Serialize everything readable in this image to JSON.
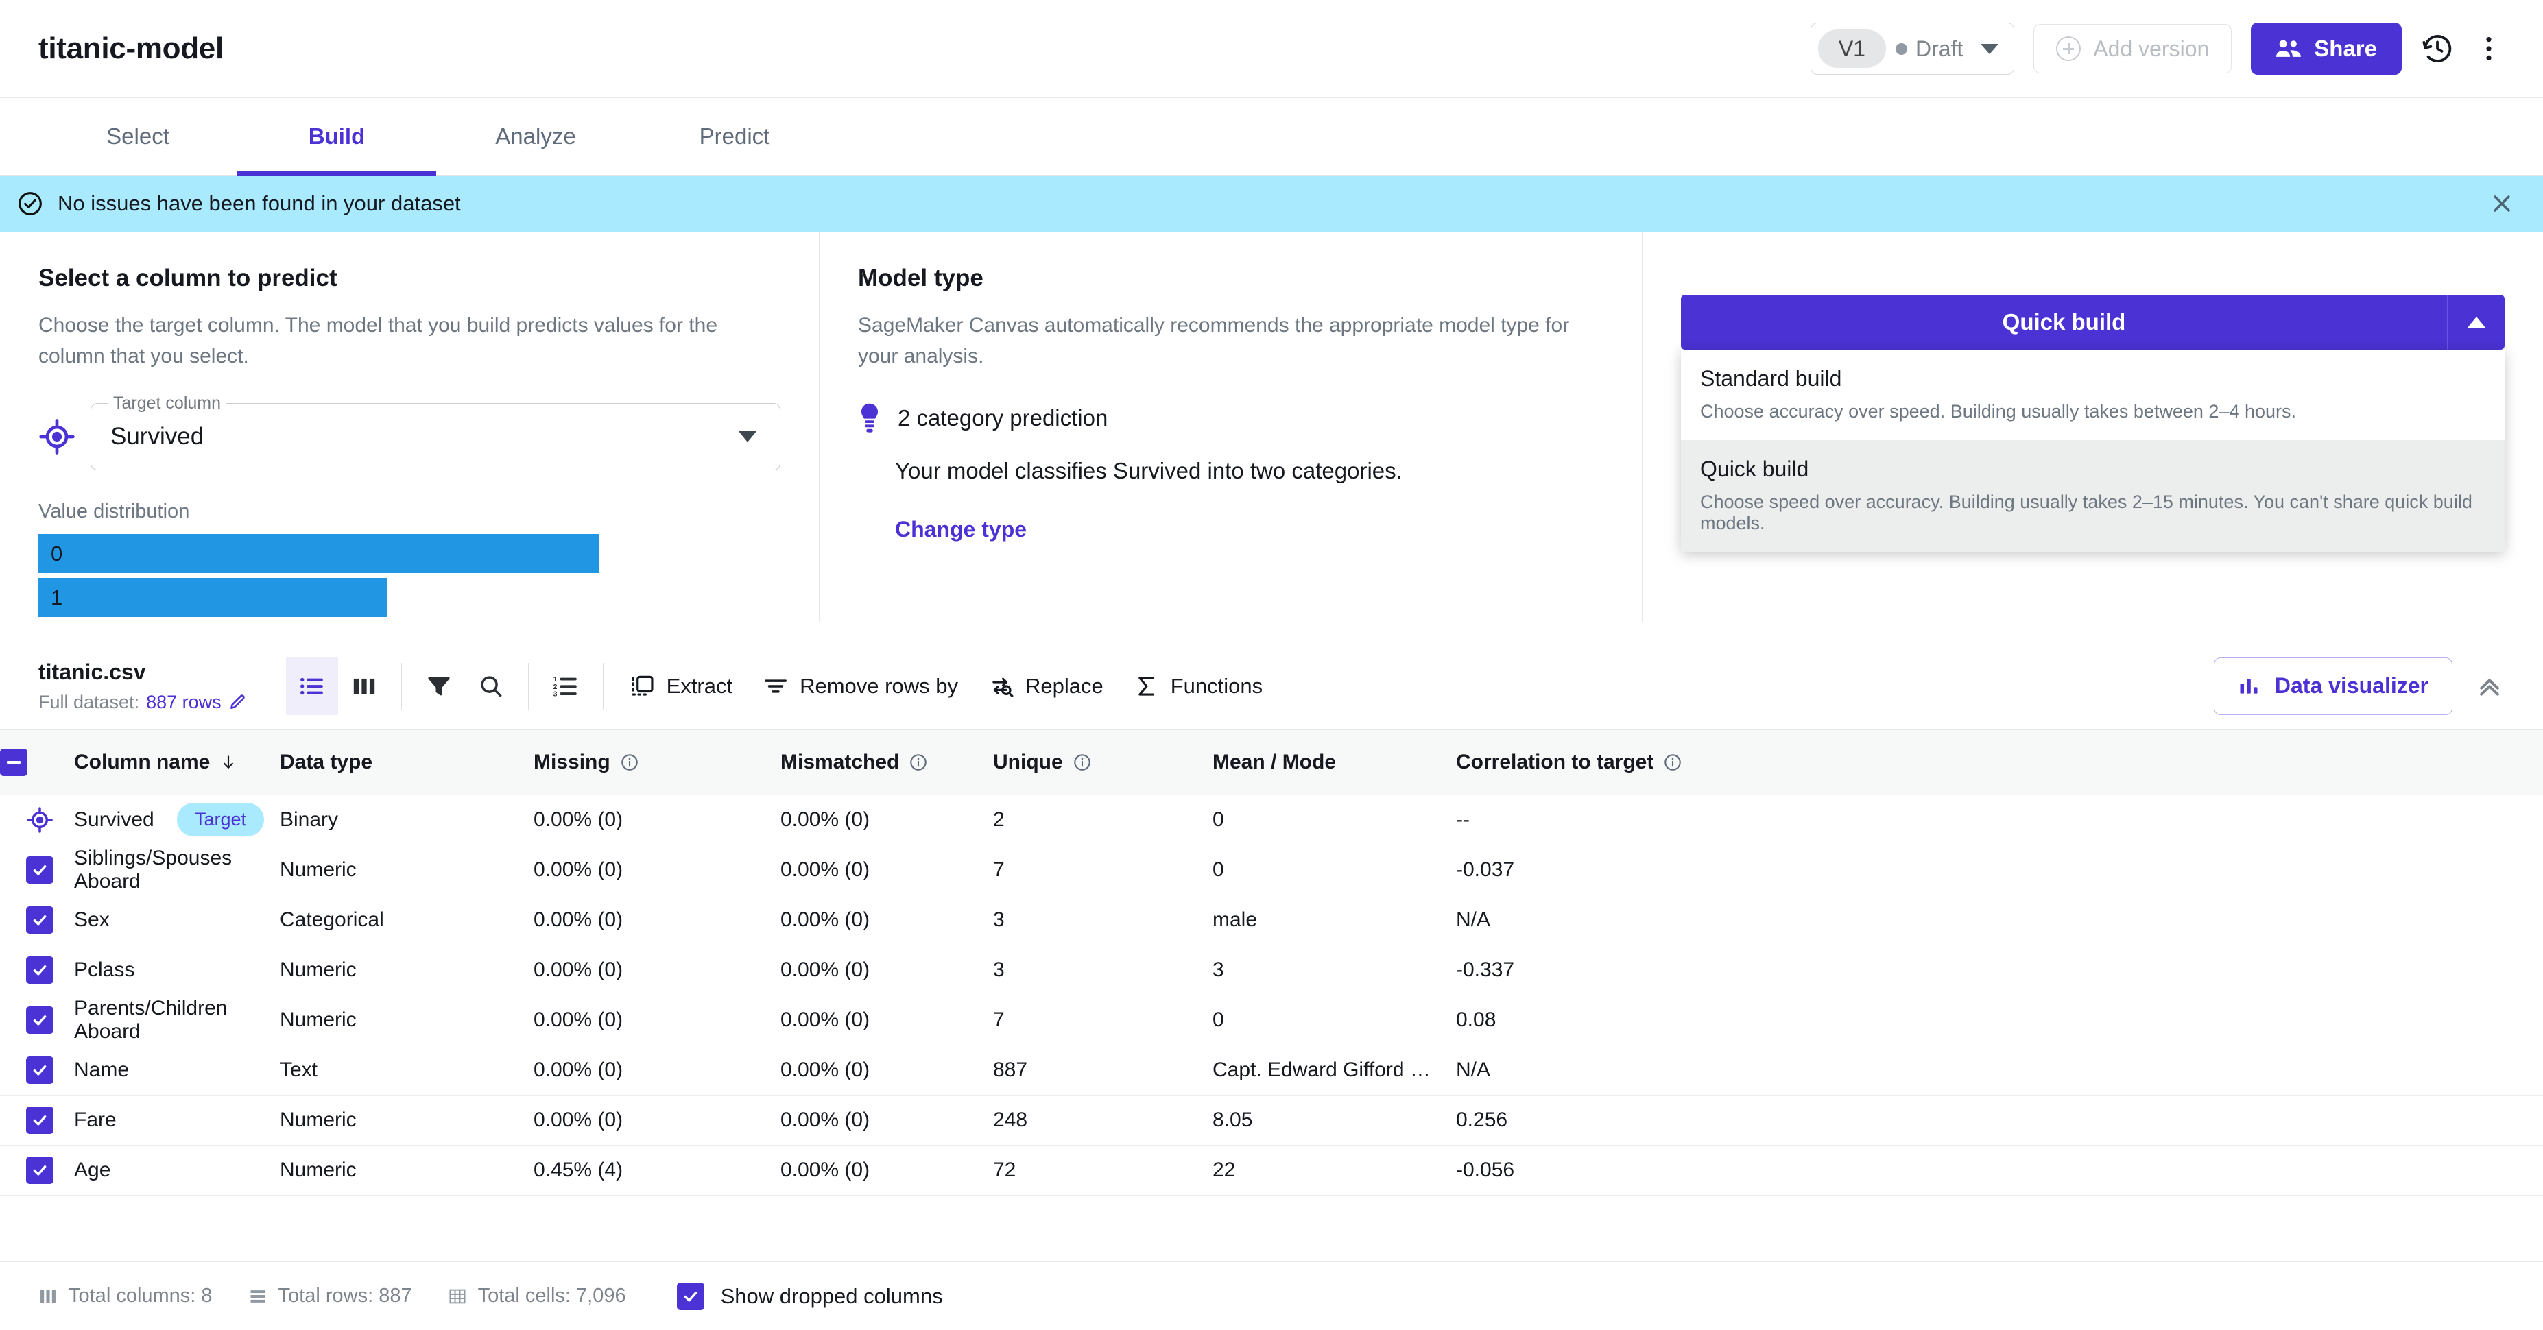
{
  "header": {
    "model_title": "titanic-model",
    "version_label": "V1",
    "status_label": "Draft",
    "add_version_label": "Add version",
    "share_label": "Share",
    "history_icon": "history-clock-icon",
    "more_icon": "more-vertical-icon",
    "accent_color": "#4b32d4"
  },
  "tabs": [
    {
      "label": "Select",
      "active": false
    },
    {
      "label": "Build",
      "active": true
    },
    {
      "label": "Analyze",
      "active": false
    },
    {
      "label": "Predict",
      "active": false
    }
  ],
  "banner": {
    "text": "No issues have been found in your dataset",
    "icon": "check-circle-icon",
    "close_icon": "close-icon",
    "background": "#aaeaff"
  },
  "predict_panel": {
    "heading": "Select a column to predict",
    "description": "Choose the target column. The model that you build predicts values for the column that you select.",
    "target_icon": "crosshair-target-icon",
    "field_legend": "Target column",
    "field_value": "Survived",
    "distribution_label": "Value distribution",
    "distribution": [
      {
        "label": "0",
        "width_pct": 100
      },
      {
        "label": "1",
        "width_pct": 62
      }
    ],
    "bar_color": "#2196e3"
  },
  "model_type_panel": {
    "heading": "Model type",
    "description": "SageMaker Canvas automatically recommends the appropriate model type for your analysis.",
    "prediction_icon": "lightbulb-icon",
    "prediction_label": "2 category prediction",
    "prediction_description": "Your model classifies Survived into two categories.",
    "change_type_label": "Change type"
  },
  "build_panel": {
    "button_label": "Quick build",
    "caret_icon": "chevron-up-icon",
    "expanded": true,
    "options": [
      {
        "label": "Standard build",
        "description": "Choose accuracy over speed. Building usually takes between 2–4 hours.",
        "highlighted": false
      },
      {
        "label": "Quick build",
        "description": "Choose speed over accuracy. Building usually takes 2–15 minutes. You can't share quick build models.",
        "highlighted": true
      }
    ]
  },
  "dataset_toolbar": {
    "filename": "titanic.csv",
    "meta_prefix": "Full dataset:",
    "row_count": "887 rows",
    "edit_icon": "pencil-icon",
    "icon_tools": [
      {
        "name": "list-view-icon",
        "selected": true
      },
      {
        "name": "grid-view-icon",
        "selected": false
      },
      {
        "name": "filter-icon",
        "selected": false
      },
      {
        "name": "search-icon",
        "selected": false
      },
      {
        "name": "ordered-list-icon",
        "selected": false
      }
    ],
    "labeled_tools": [
      {
        "label": "Extract",
        "icon": "extract-icon"
      },
      {
        "label": "Remove rows by",
        "icon": "remove-rows-icon"
      },
      {
        "label": "Replace",
        "icon": "replace-icon"
      },
      {
        "label": "Functions",
        "icon": "sigma-icon"
      }
    ],
    "data_visualizer_label": "Data visualizer",
    "data_visualizer_icon": "bar-chart-icon",
    "collapse_icon": "double-chevron-up-icon"
  },
  "table": {
    "headers": [
      {
        "label": "Column name",
        "sort_icon": "arrow-down-icon",
        "info": false
      },
      {
        "label": "Data type",
        "info": false
      },
      {
        "label": "Missing",
        "info": true
      },
      {
        "label": "Mismatched",
        "info": true
      },
      {
        "label": "Unique",
        "info": true
      },
      {
        "label": "Mean / Mode",
        "info": false
      },
      {
        "label": "Correlation to target",
        "info": true
      }
    ],
    "rows": [
      {
        "name": "Survived",
        "badge": "Target",
        "is_target": true,
        "checked": false,
        "data_type": "Binary",
        "missing": "0.00% (0)",
        "missing_muted": false,
        "mismatched": "0.00% (0)",
        "unique": "2",
        "mean_mode": "0",
        "correlation": "--"
      },
      {
        "name": "Siblings/Spouses Aboard",
        "badge": "",
        "is_target": false,
        "checked": true,
        "data_type": "Numeric",
        "missing": "0.00% (0)",
        "missing_muted": false,
        "mismatched": "0.00% (0)",
        "unique": "7",
        "mean_mode": "0",
        "correlation": "-0.037"
      },
      {
        "name": "Sex",
        "badge": "",
        "is_target": false,
        "checked": true,
        "data_type": "Categorical",
        "missing": "0.00% (0)",
        "missing_muted": false,
        "mismatched": "0.00% (0)",
        "unique": "3",
        "mean_mode": "male",
        "correlation": "N/A"
      },
      {
        "name": "Pclass",
        "badge": "",
        "is_target": false,
        "checked": true,
        "data_type": "Numeric",
        "missing": "0.00% (0)",
        "missing_muted": false,
        "mismatched": "0.00% (0)",
        "unique": "3",
        "mean_mode": "3",
        "correlation": "-0.337"
      },
      {
        "name": "Parents/Children Aboard",
        "badge": "",
        "is_target": false,
        "checked": true,
        "data_type": "Numeric",
        "missing": "0.00% (0)",
        "missing_muted": false,
        "mismatched": "0.00% (0)",
        "unique": "7",
        "mean_mode": "0",
        "correlation": "0.08"
      },
      {
        "name": "Name",
        "badge": "",
        "is_target": false,
        "checked": true,
        "data_type": "Text",
        "missing": "0.00% (0)",
        "missing_muted": false,
        "mismatched": "0.00% (0)",
        "unique": "887",
        "mean_mode": "Capt. Edward Gifford …",
        "correlation": "N/A"
      },
      {
        "name": "Fare",
        "badge": "",
        "is_target": false,
        "checked": true,
        "data_type": "Numeric",
        "missing": "0.00% (0)",
        "missing_muted": false,
        "mismatched": "0.00% (0)",
        "unique": "248",
        "mean_mode": "8.05",
        "correlation": "0.256"
      },
      {
        "name": "Age",
        "badge": "",
        "is_target": false,
        "checked": true,
        "data_type": "Numeric",
        "missing": "0.45% (4)",
        "missing_muted": true,
        "mismatched": "0.00% (0)",
        "unique": "72",
        "mean_mode": "22",
        "correlation": "-0.056"
      }
    ]
  },
  "footer": {
    "total_columns": "Total columns: 8",
    "total_rows": "Total rows: 887",
    "total_cells": "Total cells: 7,096",
    "show_dropped_label": "Show dropped columns",
    "show_dropped_checked": true
  }
}
